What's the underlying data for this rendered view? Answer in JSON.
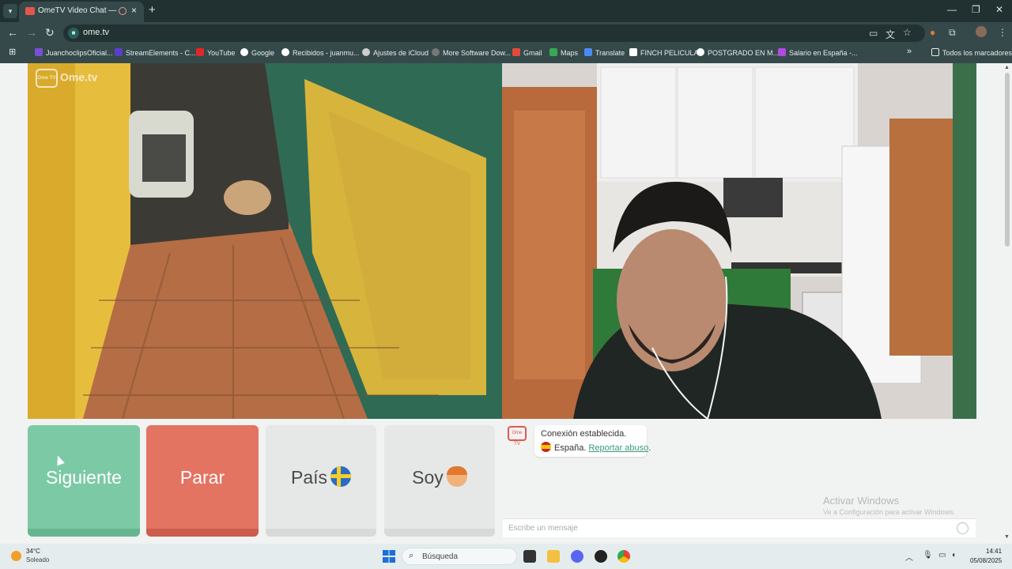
{
  "browser": {
    "tab_title": "OmeTV Video Chat — Ome...",
    "tab_close": "×",
    "new_tab": "+",
    "url": "ome.tv",
    "bookmarks": [
      {
        "label": "JuanchoclipsOficial...",
        "color": "#7b4fd6"
      },
      {
        "label": "StreamElements - C...",
        "color": "#5a3ec8"
      },
      {
        "label": "YouTube",
        "color": "#e02626"
      },
      {
        "label": "Google",
        "color": "#ffffff"
      },
      {
        "label": "Recibidos - juanmu...",
        "color": "#ffffff"
      },
      {
        "label": "Ajustes de iCloud",
        "color": "#cccccc"
      },
      {
        "label": "More Software Dow...",
        "color": "#777777"
      },
      {
        "label": "Gmail",
        "color": "#e04b3c"
      },
      {
        "label": "Maps",
        "color": "#34a853"
      },
      {
        "label": "Translate",
        "color": "#4a8af4"
      },
      {
        "label": "FINCH PELICULA",
        "color": "#ffffff"
      },
      {
        "label": "POSTGRADO EN M...",
        "color": "#ffffff"
      },
      {
        "label": "Salario en España -...",
        "color": "#b04ae0"
      }
    ],
    "all_bookmarks": "Todos los marcadores"
  },
  "site": {
    "logo_text": "Ome.tv",
    "logo_badge": "Ome TV",
    "buttons": {
      "next": "Siguiente",
      "stop": "Parar",
      "country": "País",
      "me": "Soy"
    }
  },
  "chat": {
    "logo_badge": "Ome TV",
    "connection_msg": "Conexión establecida.",
    "country": "España.",
    "report_link": "Reportar abuso",
    "report_suffix": ".",
    "placeholder": "Escribe un mensaje",
    "watermark_title": "Activar Windows",
    "watermark_sub": "Ve a Configuración para activar Windows."
  },
  "taskbar": {
    "temperature": "34°C",
    "weather": "Soleado",
    "search": "Búsqueda",
    "time": "14:41",
    "date": "05/08/2025"
  }
}
